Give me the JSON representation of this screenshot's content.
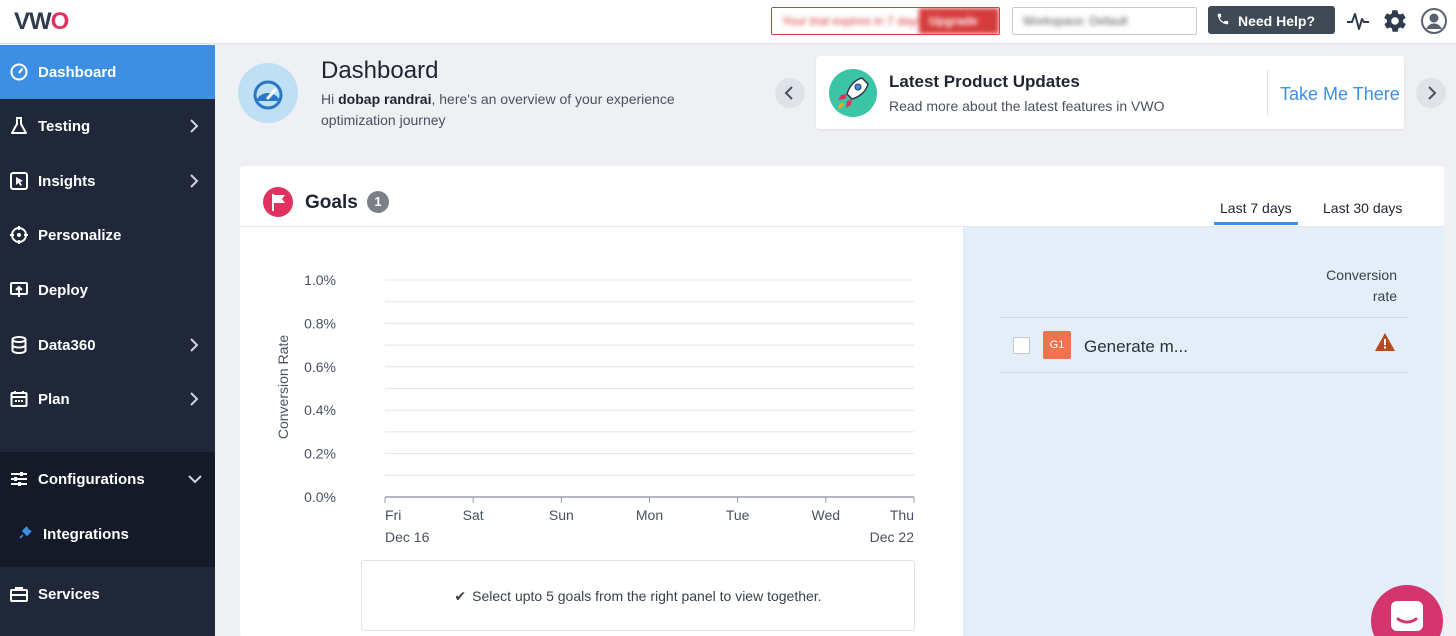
{
  "topbar": {
    "logo_text_a": "VW",
    "logo_text_b": "O",
    "upgrade_text": "Your trial expires in 7 days",
    "upgrade_button": "Upgrade",
    "account_text": "Workspace: Default",
    "help_label": "Need Help?",
    "icons": [
      "phone-icon",
      "activity-icon",
      "gear-icon",
      "user-icon"
    ]
  },
  "sidebar": {
    "items": [
      {
        "label": "Dashboard",
        "icon": "gauge-icon",
        "active": true
      },
      {
        "label": "Testing",
        "icon": "flask-icon"
      },
      {
        "label": "Insights",
        "icon": "cursor-icon"
      },
      {
        "label": "Personalize",
        "icon": "target-icon"
      },
      {
        "label": "Deploy",
        "icon": "upload-icon"
      },
      {
        "label": "Data360",
        "icon": "database-icon"
      },
      {
        "label": "Plan",
        "icon": "calendar-icon"
      }
    ],
    "config_label": "Configurations",
    "integrations_label": "Integrations",
    "services_label": "Services"
  },
  "header": {
    "title": "Dashboard",
    "greeting_prefix": "Hi ",
    "user_name": "dobap randrai",
    "greeting_suffix": ", here's an overview of your experience optimization journey"
  },
  "updates": {
    "title": "Latest Product Updates",
    "description": "Read more about the latest features in VWO",
    "cta": "Take Me There"
  },
  "goals": {
    "title": "Goals",
    "count": "1",
    "tabs": [
      "Last 7 days",
      "Last 30 days"
    ],
    "active_tab": "Last 7 days",
    "conversion_header": "Conversion rate",
    "conversion_header_line1": "Conversion",
    "conversion_header_line2": "rate",
    "list": [
      {
        "badge": "G1",
        "name": "Generate m...",
        "status": "warning"
      }
    ],
    "hint": "Select upto 5 goals from the right panel to view together."
  },
  "chart_data": {
    "type": "line",
    "ylabel": "Conversion Rate",
    "xlabel": "",
    "ylim": [
      0,
      1.0
    ],
    "y_ticks": [
      "1.0%",
      "0.8%",
      "0.6%",
      "0.4%",
      "0.2%",
      "0.0%"
    ],
    "y_tick_values": [
      1.0,
      0.8,
      0.6,
      0.4,
      0.2,
      0.0
    ],
    "categories": [
      "Fri",
      "Sat",
      "Sun",
      "Mon",
      "Tue",
      "Wed",
      "Thu"
    ],
    "date_start": "Dec 16",
    "date_end": "Dec 22",
    "series": [],
    "grid": true
  }
}
